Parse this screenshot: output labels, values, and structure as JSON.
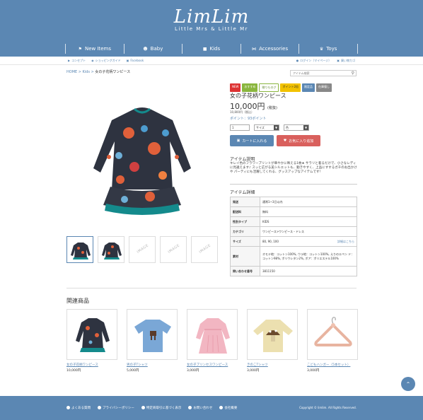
{
  "brand": {
    "logo_main": "LimLim",
    "logo_sub": "Little Mrs & Little Mr"
  },
  "gnav": [
    {
      "label": "New Items",
      "icon": "tag-icon"
    },
    {
      "label": "Baby",
      "icon": "baby-icon"
    },
    {
      "label": "Kids",
      "icon": "shirt-icon"
    },
    {
      "label": "Accessories",
      "icon": "bow-icon"
    },
    {
      "label": "Toys",
      "icon": "toy-icon"
    }
  ],
  "subbar": {
    "concept": "コンセプト",
    "guide": "ショッピングガイド",
    "facebook": "Facebook",
    "login": "ログイン（マイページ）",
    "cart": "買い物カゴ"
  },
  "breadcrumb": {
    "home": "HOME",
    "sep": " > ",
    "kids": "Kids",
    "current": "女の子花柄ワンピース"
  },
  "search": {
    "placeholder": "アイテム検索"
  },
  "product": {
    "badges": [
      "NEW",
      "おすすめ",
      "贈りものグ",
      "ポイント2倍",
      "限定品",
      "在庫僅し"
    ],
    "title": "女の子花柄ワンピース",
    "price": "10,000円",
    "tax_label": "(税抜)",
    "price_incl": "10,800円（税込）",
    "points": "ポイント：93ポイント",
    "qty": "1",
    "size_label": "サイズ",
    "color_label": "色",
    "cart_button": "カートに入れる",
    "fav_button": "お気に入り追加"
  },
  "description": {
    "heading": "アイテム説明",
    "text": "キレイ色のフラワープリントが華やかに映える1枚★ サラリと着るだけで、小さなレディに見違えます♪ スッと広がる美シルエットも、動きやすく、上品にすするガチのお出かけや パーティにも活躍してくれる、グッスアップなアイテムです！"
  },
  "spec": {
    "heading": "アイテム詳細",
    "rows": [
      {
        "k": "発送",
        "v": "通常1~3日以内"
      },
      {
        "k": "配送料",
        "v": "無料"
      },
      {
        "k": "性別タイプ",
        "v": "KIDS"
      },
      {
        "k": "カテゴリ",
        "v": "ワンピース>ワンピース・ドレス"
      },
      {
        "k": "サイズ",
        "v": "80, 90, 100",
        "link": "詳細はこちら"
      },
      {
        "k": "素材",
        "v": "オモテ地：コットン100%, ウラ地：コットン100%, えりのエペン ド：コットン98%, ポリウレタン2%, ボア：ポリエステル100%"
      },
      {
        "k": "問い合わせ番号",
        "v": "3811150"
      }
    ]
  },
  "no_image_label": "IMAGE",
  "related": {
    "heading": "関連商品",
    "items": [
      {
        "name": "女の子花柄ワンピース",
        "price": "10,000円"
      },
      {
        "name": "男の子Tシャツ",
        "price": "5,000円"
      },
      {
        "name": "女の子プリンセスワンピース",
        "price": "3,000円"
      },
      {
        "name": "きのこTシャツ",
        "price": "3,000円"
      },
      {
        "name": "こどもハンガー（5本セット）",
        "price": "3,000円"
      }
    ]
  },
  "footer": {
    "links": [
      "よくある質問",
      "プライバシーポリシー",
      "特定商取引に基づく表示",
      "お問い合わせ",
      "会社概要"
    ],
    "copyright": "Copyright © limlim. All Rights Reserved."
  },
  "colors": {
    "primary": "#5b87b3",
    "new": "#dd3333",
    "fav": "#d9605d"
  }
}
